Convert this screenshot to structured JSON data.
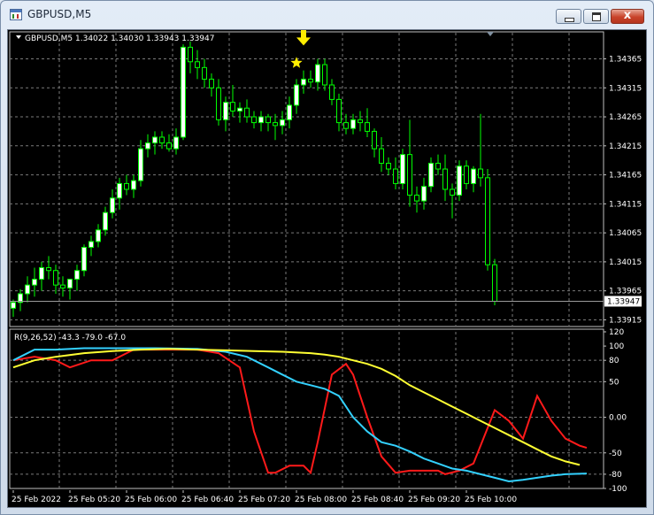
{
  "window": {
    "title": "GBPUSD,M5",
    "close_glyph": "x"
  },
  "colors": {
    "background": "#000000",
    "grid": "#7a7a7a",
    "bull_candle": "#ffffff",
    "bear_candle": "#000000",
    "wick": "#00ff00",
    "rsi_fast": "#ff1a1a",
    "rsi_mid": "#33d1ff",
    "rsi_slow": "#ffff33",
    "marker": "#ffee00"
  },
  "icons": {
    "signal_arrow": "arrow-down-icon",
    "signal_star": "star-icon"
  },
  "chart_data": {
    "price": {
      "type": "candlestick",
      "header": "GBPUSD,M5  1.34022 1.34030 1.33943 1.33947",
      "symbol": "GBPUSD,M5",
      "ohlc_header": [
        "1.34022",
        "1.34030",
        "1.33943",
        "1.33947"
      ],
      "y_ticks": [
        "1.34365",
        "1.34315",
        "1.34265",
        "1.34215",
        "1.34165",
        "1.34115",
        "1.34065",
        "1.34015",
        "1.33965",
        "1.33915"
      ],
      "ylim": [
        1.33905,
        1.3441
      ],
      "current_price": 1.33947,
      "current_price_label": "1.33947",
      "candles": [
        [
          1.33935,
          1.3395,
          1.3392,
          1.33945
        ],
        [
          1.33945,
          1.33968,
          1.3393,
          1.3396
        ],
        [
          1.3396,
          1.3399,
          1.33945,
          1.33975
        ],
        [
          1.33975,
          1.34005,
          1.33955,
          1.33985
        ],
        [
          1.33985,
          1.34015,
          1.33965,
          1.34005
        ],
        [
          1.34005,
          1.34025,
          1.33985,
          1.34
        ],
        [
          1.34,
          1.3401,
          1.3396,
          1.33975
        ],
        [
          1.33975,
          1.3399,
          1.33955,
          1.3397
        ],
        [
          1.3397,
          1.33985,
          1.3395,
          1.33985
        ],
        [
          1.33985,
          1.3401,
          1.33965,
          1.34
        ],
        [
          1.34,
          1.34045,
          1.3399,
          1.3404
        ],
        [
          1.3404,
          1.3406,
          1.34025,
          1.3405
        ],
        [
          1.3405,
          1.3408,
          1.3404,
          1.3407
        ],
        [
          1.3407,
          1.3411,
          1.3406,
          1.341
        ],
        [
          1.341,
          1.3414,
          1.3409,
          1.34125
        ],
        [
          1.34125,
          1.3416,
          1.34105,
          1.3415
        ],
        [
          1.3415,
          1.34165,
          1.3413,
          1.3414
        ],
        [
          1.3414,
          1.34165,
          1.34125,
          1.34155
        ],
        [
          1.34155,
          1.34225,
          1.34145,
          1.3421
        ],
        [
          1.3421,
          1.34235,
          1.34195,
          1.3422
        ],
        [
          1.3422,
          1.3424,
          1.342,
          1.3423
        ],
        [
          1.3423,
          1.3424,
          1.3421,
          1.3422
        ],
        [
          1.3422,
          1.34235,
          1.34205,
          1.3421
        ],
        [
          1.3421,
          1.34245,
          1.342,
          1.3423
        ],
        [
          1.3423,
          1.3439,
          1.34225,
          1.34385
        ],
        [
          1.34385,
          1.34395,
          1.3434,
          1.3436
        ],
        [
          1.3436,
          1.3438,
          1.3433,
          1.3435
        ],
        [
          1.3435,
          1.34365,
          1.34315,
          1.3433
        ],
        [
          1.3433,
          1.3434,
          1.343,
          1.34315
        ],
        [
          1.34315,
          1.3433,
          1.3425,
          1.3426
        ],
        [
          1.3426,
          1.343,
          1.3424,
          1.3429
        ],
        [
          1.3429,
          1.3432,
          1.34265,
          1.34275
        ],
        [
          1.34275,
          1.3429,
          1.34255,
          1.3428
        ],
        [
          1.3428,
          1.34295,
          1.34255,
          1.34265
        ],
        [
          1.34265,
          1.34275,
          1.34245,
          1.34255
        ],
        [
          1.34255,
          1.34275,
          1.3424,
          1.34265
        ],
        [
          1.34265,
          1.3427,
          1.3424,
          1.34255
        ],
        [
          1.34255,
          1.3427,
          1.34225,
          1.3425
        ],
        [
          1.3425,
          1.34275,
          1.34235,
          1.3426
        ],
        [
          1.3426,
          1.343,
          1.34245,
          1.34285
        ],
        [
          1.34285,
          1.3433,
          1.3427,
          1.3432
        ],
        [
          1.3432,
          1.34345,
          1.34305,
          1.3433
        ],
        [
          1.3433,
          1.34345,
          1.34315,
          1.34325
        ],
        [
          1.34325,
          1.34365,
          1.3431,
          1.34355
        ],
        [
          1.34355,
          1.34365,
          1.3431,
          1.3432
        ],
        [
          1.3432,
          1.3433,
          1.34285,
          1.34295
        ],
        [
          1.34295,
          1.34305,
          1.3424,
          1.34255
        ],
        [
          1.34255,
          1.3427,
          1.34235,
          1.34245
        ],
        [
          1.34245,
          1.3427,
          1.34235,
          1.3426
        ],
        [
          1.3426,
          1.34275,
          1.3424,
          1.34255
        ],
        [
          1.34255,
          1.3428,
          1.3423,
          1.3424
        ],
        [
          1.3424,
          1.34245,
          1.34195,
          1.3421
        ],
        [
          1.3421,
          1.3423,
          1.3417,
          1.34185
        ],
        [
          1.34185,
          1.34195,
          1.34165,
          1.34175
        ],
        [
          1.34175,
          1.34195,
          1.3414,
          1.3415
        ],
        [
          1.3415,
          1.3421,
          1.3414,
          1.342
        ],
        [
          1.342,
          1.3426,
          1.3411,
          1.3413
        ],
        [
          1.3413,
          1.34145,
          1.341,
          1.3412
        ],
        [
          1.3412,
          1.3416,
          1.34105,
          1.34145
        ],
        [
          1.34145,
          1.34195,
          1.34135,
          1.34185
        ],
        [
          1.34185,
          1.342,
          1.34165,
          1.34175
        ],
        [
          1.34175,
          1.342,
          1.3412,
          1.3414
        ],
        [
          1.3414,
          1.3415,
          1.3409,
          1.3413
        ],
        [
          1.3413,
          1.3419,
          1.3412,
          1.3418
        ],
        [
          1.3418,
          1.3419,
          1.3414,
          1.3415
        ],
        [
          1.3415,
          1.3418,
          1.34135,
          1.34175
        ],
        [
          1.34175,
          1.3427,
          1.34145,
          1.3416
        ],
        [
          1.3416,
          1.34175,
          1.34,
          1.3401
        ],
        [
          1.3401,
          1.3402,
          1.3394,
          1.33947
        ]
      ],
      "annotations": [
        {
          "type": "arrow-down",
          "candle_index": 41,
          "price": 1.34385
        },
        {
          "type": "star",
          "candle_index": 40,
          "price": 1.34358
        }
      ]
    },
    "indicator": {
      "type": "line",
      "header": "R(9,26,52) -43.3 -79.0 -67.0",
      "name": "R(9,26,52)",
      "values_header": [
        "-43.3",
        "-79.0",
        "-67.0"
      ],
      "ylim": [
        -100,
        120
      ],
      "y_ticks": [
        "120",
        "100",
        "80",
        "50",
        "0.00",
        "-50",
        "-80",
        "-100"
      ],
      "y_tick_values": [
        120,
        100,
        80,
        50,
        0,
        -50,
        -80,
        -100
      ],
      "gridlines": [
        80,
        50,
        0,
        -50,
        -80
      ],
      "series": [
        {
          "color": "#ff1a1a",
          "points": [
            [
              0,
              80
            ],
            [
              3,
              85
            ],
            [
              6,
              80
            ],
            [
              8,
              70
            ],
            [
              11,
              80
            ],
            [
              14,
              80
            ],
            [
              17,
              95
            ],
            [
              20,
              95
            ],
            [
              24,
              95
            ],
            [
              26,
              95
            ],
            [
              29,
              90
            ],
            [
              32,
              70
            ],
            [
              34,
              -20
            ],
            [
              36,
              -78
            ],
            [
              37,
              -78
            ],
            [
              39,
              -68
            ],
            [
              41,
              -68
            ],
            [
              42,
              -78
            ],
            [
              43,
              -35
            ],
            [
              45,
              60
            ],
            [
              47,
              75
            ],
            [
              48,
              60
            ],
            [
              50,
              0
            ],
            [
              52,
              -55
            ],
            [
              54,
              -78
            ],
            [
              56,
              -75
            ],
            [
              58,
              -75
            ],
            [
              60,
              -75
            ],
            [
              61,
              -80
            ],
            [
              63,
              -75
            ],
            [
              65,
              -65
            ],
            [
              67,
              -15
            ],
            [
              68,
              10
            ],
            [
              70,
              -5
            ],
            [
              72,
              -30
            ],
            [
              74,
              30
            ],
            [
              76,
              -5
            ],
            [
              78,
              -30
            ],
            [
              80,
              -40
            ],
            [
              81,
              -43
            ]
          ]
        },
        {
          "color": "#33d1ff",
          "points": [
            [
              0,
              80
            ],
            [
              3,
              95
            ],
            [
              6,
              95
            ],
            [
              10,
              97
            ],
            [
              14,
              97
            ],
            [
              20,
              97
            ],
            [
              26,
              96
            ],
            [
              30,
              92
            ],
            [
              33,
              85
            ],
            [
              36,
              70
            ],
            [
              38,
              60
            ],
            [
              40,
              50
            ],
            [
              42,
              45
            ],
            [
              44,
              40
            ],
            [
              46,
              30
            ],
            [
              48,
              0
            ],
            [
              50,
              -20
            ],
            [
              52,
              -35
            ],
            [
              54,
              -40
            ],
            [
              56,
              -48
            ],
            [
              58,
              -58
            ],
            [
              60,
              -65
            ],
            [
              62,
              -72
            ],
            [
              64,
              -75
            ],
            [
              66,
              -80
            ],
            [
              68,
              -85
            ],
            [
              70,
              -90
            ],
            [
              72,
              -88
            ],
            [
              74,
              -85
            ],
            [
              76,
              -82
            ],
            [
              78,
              -80
            ],
            [
              81,
              -79
            ]
          ]
        },
        {
          "color": "#ffff33",
          "points": [
            [
              0,
              70
            ],
            [
              3,
              80
            ],
            [
              6,
              85
            ],
            [
              10,
              90
            ],
            [
              14,
              93
            ],
            [
              18,
              95
            ],
            [
              22,
              96
            ],
            [
              26,
              95
            ],
            [
              30,
              94
            ],
            [
              34,
              93
            ],
            [
              38,
              92
            ],
            [
              42,
              90
            ],
            [
              44,
              88
            ],
            [
              46,
              85
            ],
            [
              48,
              80
            ],
            [
              50,
              75
            ],
            [
              52,
              68
            ],
            [
              54,
              58
            ],
            [
              56,
              45
            ],
            [
              58,
              35
            ],
            [
              60,
              25
            ],
            [
              62,
              15
            ],
            [
              64,
              5
            ],
            [
              66,
              -5
            ],
            [
              68,
              -15
            ],
            [
              70,
              -25
            ],
            [
              72,
              -35
            ],
            [
              74,
              -45
            ],
            [
              76,
              -55
            ],
            [
              78,
              -62
            ],
            [
              80,
              -67
            ]
          ]
        }
      ]
    },
    "x_ticks": [
      "25 Feb 2022",
      "25 Feb 05:20",
      "25 Feb 06:00",
      "25 Feb 06:40",
      "25 Feb 07:20",
      "25 Feb 08:00",
      "25 Feb 08:40",
      "25 Feb 09:20",
      "25 Feb 10:00"
    ]
  }
}
